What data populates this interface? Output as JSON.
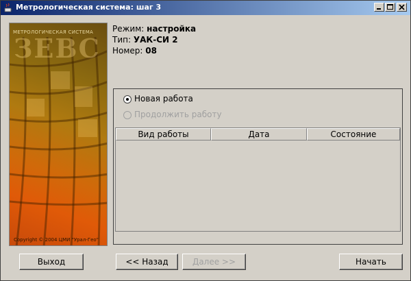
{
  "window": {
    "title": "Метрологическая система: шаг 3",
    "controls": [
      "minimize-icon",
      "maximize-icon",
      "close-icon"
    ]
  },
  "banner": {
    "caption": "МЕТРОЛОГИЧЕСКАЯ СИСТЕМА",
    "logo": "ЗЕВС",
    "copyright": "Copyright © 2004 ЦМИ \"Урал-Гео\""
  },
  "info": {
    "mode_label": "Режим:",
    "mode_value": "настройка",
    "type_label": "Тип:",
    "type_value": "УАК-СИ 2",
    "number_label": "Номер:",
    "number_value": "08"
  },
  "options": {
    "new_work": "Новая работа",
    "continue_work": "Продолжить работу"
  },
  "table": {
    "columns": [
      "Вид работы",
      "Дата",
      "Состояние"
    ],
    "rows": []
  },
  "buttons": {
    "exit": "Выход",
    "back": "<< Назад",
    "next": "Далее >>",
    "start": "Начать"
  }
}
